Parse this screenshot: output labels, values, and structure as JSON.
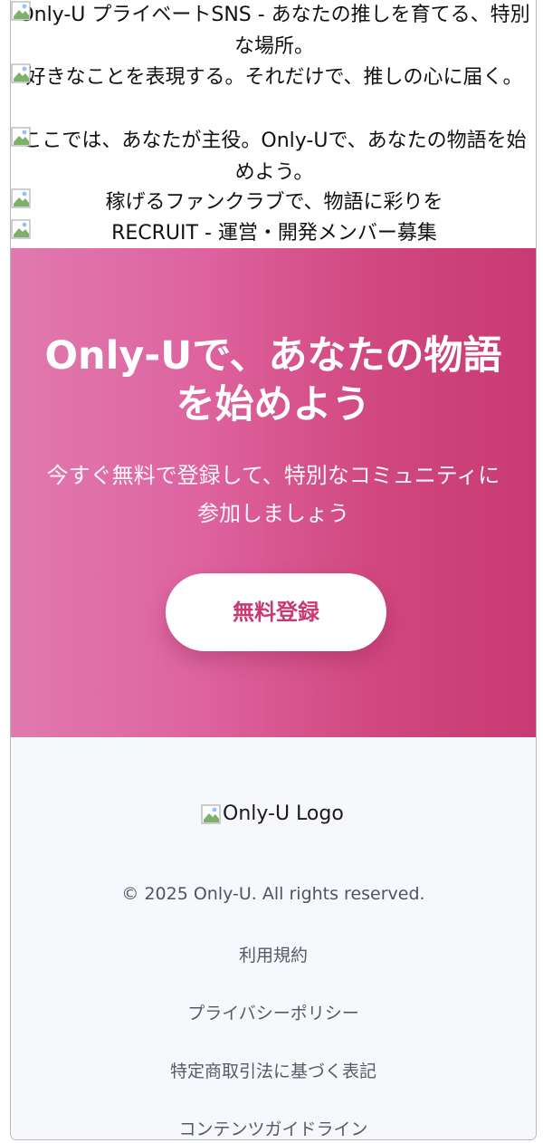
{
  "banners": [
    {
      "text": "Only-U プライベートSNS - あなたの推しを育てる、特別な場所。"
    },
    {
      "text": "好きなことを表現する。それだけで、推しの心に届く。"
    },
    {
      "text": "ここでは、あなたが主役。Only-Uで、あなたの物語を始めよう。"
    },
    {
      "text": "稼げるファンクラブで、物語に彩りを"
    },
    {
      "text": "RECRUIT - 運営・開発メンバー募集"
    }
  ],
  "cta": {
    "title": "Only-Uで、あなたの物語を始めよう",
    "subtitle": "今すぐ無料で登録して、特別なコミュニティに参加しましょう",
    "button_label": "無料登録",
    "gradient_start": "#e07aae",
    "gradient_end": "#c83a73",
    "button_text_color": "#c83a73"
  },
  "footer": {
    "logo_alt": "Only-U Logo",
    "copyright": "© 2025 Only-U. All rights reserved.",
    "links": [
      "利用規約",
      "プライバシーポリシー",
      "特定商取引法に基づく表記",
      "コンテンツガイドライン"
    ]
  },
  "icons": {
    "broken_image": "broken-image-icon"
  }
}
